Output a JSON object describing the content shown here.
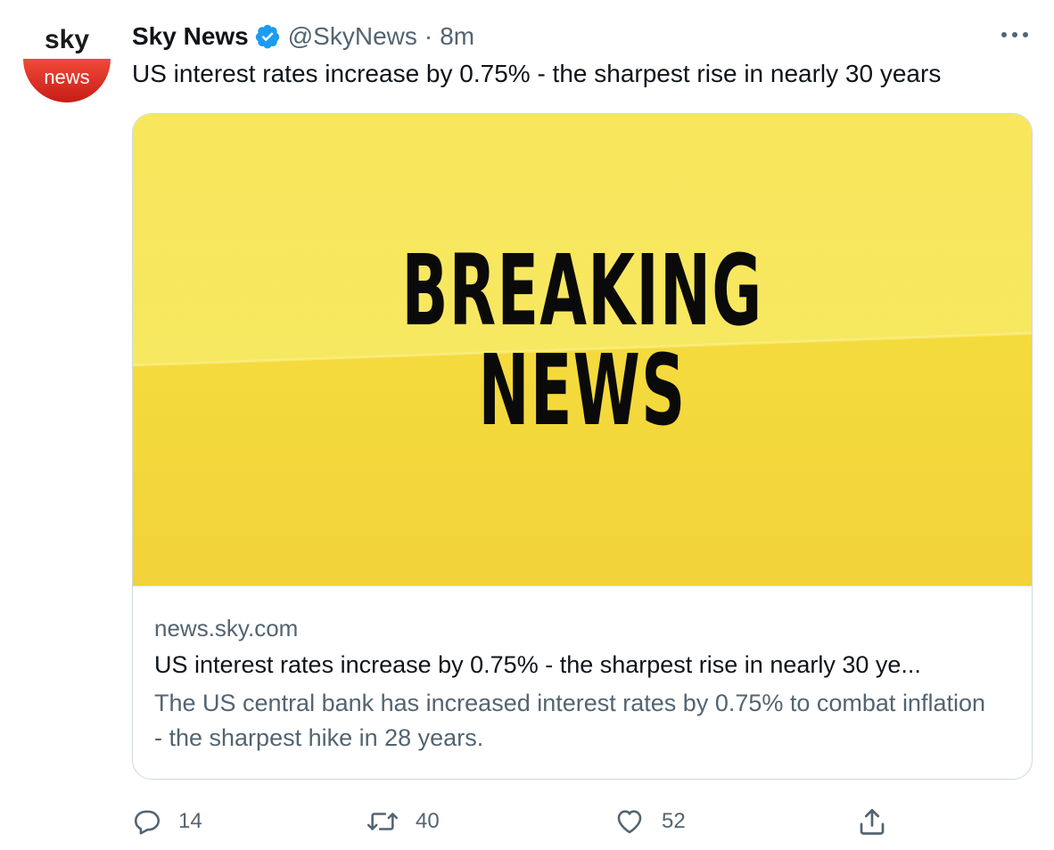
{
  "avatar": {
    "logo_top": "sky",
    "logo_bottom": "news",
    "brand_red": "#d7251b"
  },
  "tweet": {
    "display_name": "Sky News",
    "handle": "@SkyNews",
    "separator": "·",
    "time": "8m",
    "verified_color": "#1d9bf0",
    "text": "US interest rates increase by 0.75% - the sharpest rise in nearly 30 years"
  },
  "card": {
    "image_line1": "BREAKING",
    "image_line2": "NEWS",
    "image_color": "#f5e14a",
    "domain": "news.sky.com",
    "title": "US interest rates increase by 0.75% - the sharpest rise in nearly 30 ye...",
    "description": "The US central bank has increased interest rates by 0.75% to combat inflation - the sharpest hike in 28 years."
  },
  "actions": {
    "reply_icon": "reply-icon",
    "reply_count": "14",
    "retweet_icon": "retweet-icon",
    "retweet_count": "40",
    "like_icon": "heart-icon",
    "like_count": "52",
    "share_icon": "share-icon"
  }
}
